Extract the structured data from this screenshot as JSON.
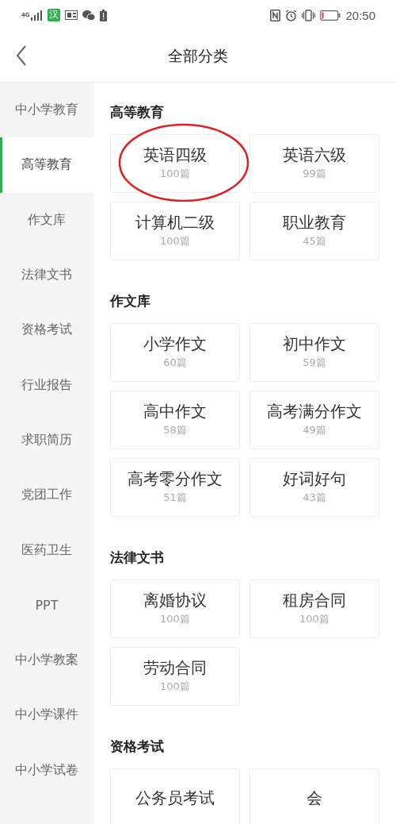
{
  "status_bar": {
    "network": "4G",
    "input_badge": "汉",
    "time": "20:50"
  },
  "header": {
    "title": "全部分类"
  },
  "sidebar": {
    "items": [
      {
        "label": "中小学教育",
        "selected": false
      },
      {
        "label": "高等教育",
        "selected": true
      },
      {
        "label": "作文库",
        "selected": false
      },
      {
        "label": "法律文书",
        "selected": false
      },
      {
        "label": "资格考试",
        "selected": false
      },
      {
        "label": "行业报告",
        "selected": false
      },
      {
        "label": "求职简历",
        "selected": false
      },
      {
        "label": "党团工作",
        "selected": false
      },
      {
        "label": "医药卫生",
        "selected": false
      },
      {
        "label": "PPT",
        "selected": false
      },
      {
        "label": "中小学教案",
        "selected": false
      },
      {
        "label": "中小学课件",
        "selected": false
      },
      {
        "label": "中小学试卷",
        "selected": false
      }
    ]
  },
  "sections": [
    {
      "title": "高等教育",
      "cards": [
        {
          "name": "英语四级",
          "count": "100篇",
          "circled": true
        },
        {
          "name": "英语六级",
          "count": "99篇",
          "circled": false
        },
        {
          "name": "计算机二级",
          "count": "100篇",
          "circled": false
        },
        {
          "name": "职业教育",
          "count": "45篇",
          "circled": false
        }
      ]
    },
    {
      "title": "作文库",
      "cards": [
        {
          "name": "小学作文",
          "count": "60篇",
          "circled": false
        },
        {
          "name": "初中作文",
          "count": "59篇",
          "circled": false
        },
        {
          "name": "高中作文",
          "count": "58篇",
          "circled": false
        },
        {
          "name": "高考满分作文",
          "count": "49篇",
          "circled": false
        },
        {
          "name": "高考零分作文",
          "count": "51篇",
          "circled": false
        },
        {
          "name": "好词好句",
          "count": "43篇",
          "circled": false
        }
      ]
    },
    {
      "title": "法律文书",
      "cards": [
        {
          "name": "离婚协议",
          "count": "100篇",
          "circled": false
        },
        {
          "name": "租房合同",
          "count": "100篇",
          "circled": false
        },
        {
          "name": "劳动合同",
          "count": "100篇",
          "circled": false
        }
      ]
    },
    {
      "title": "资格考试",
      "cards": [
        {
          "name": "公务员考试",
          "circled": false
        },
        {
          "name": "会",
          "circled": false
        }
      ]
    }
  ]
}
